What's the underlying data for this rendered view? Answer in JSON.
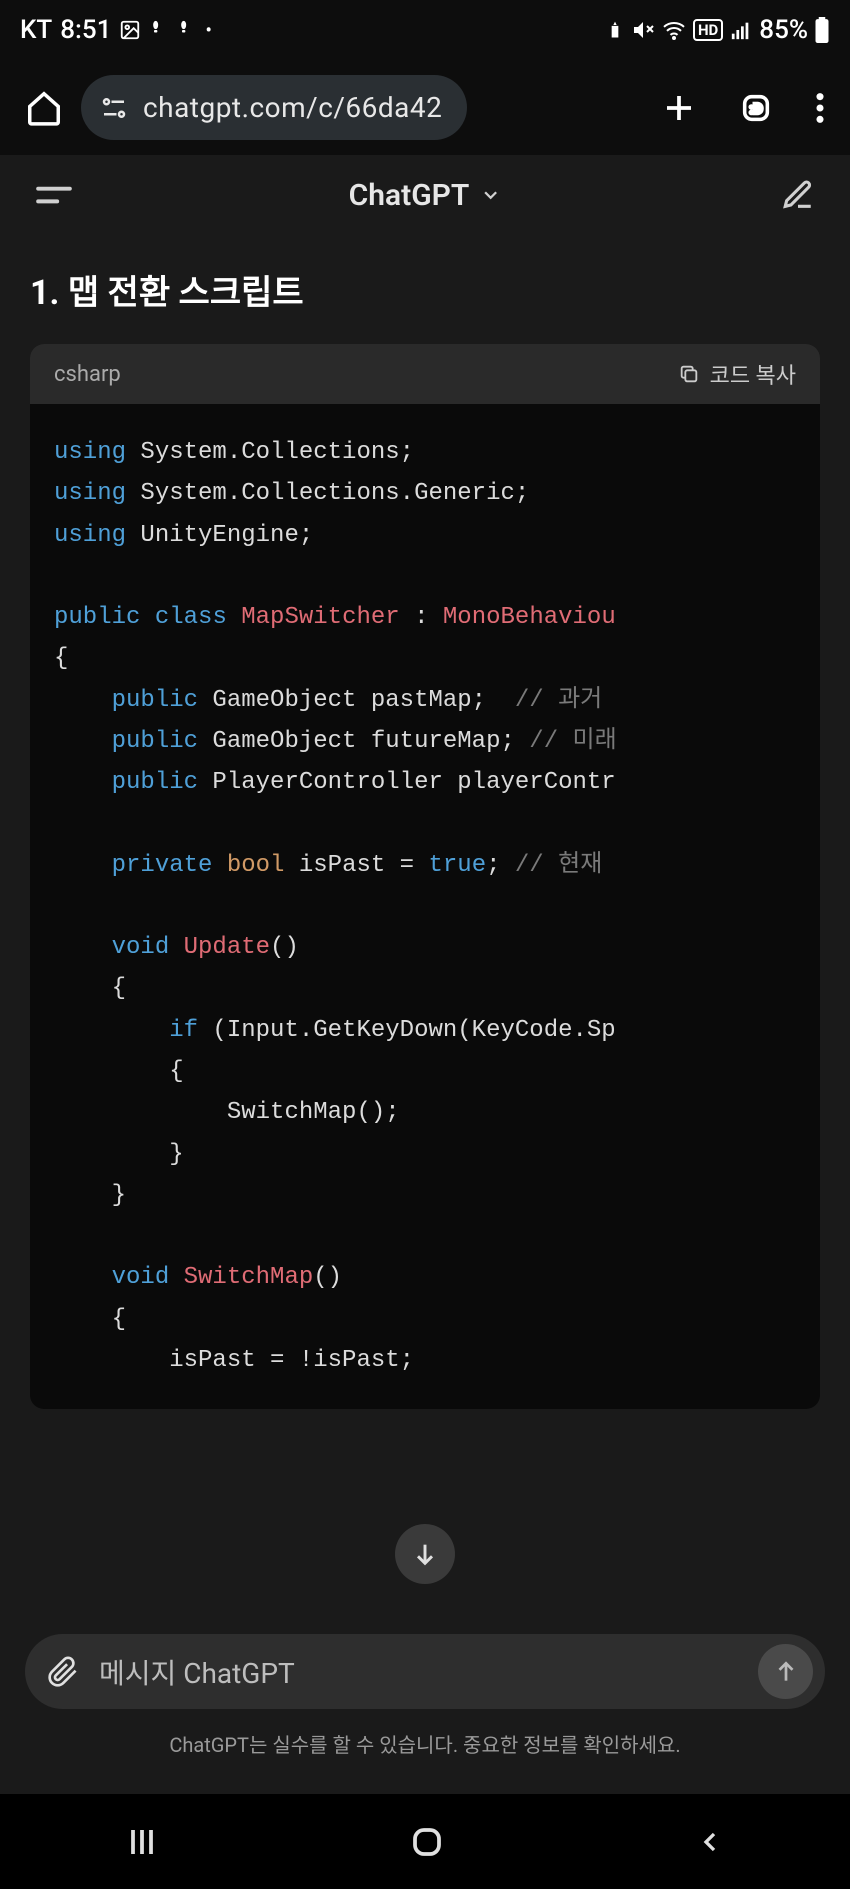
{
  "status": {
    "carrier": "KT",
    "time": "8:51",
    "battery": "85%"
  },
  "browser": {
    "url": "chatgpt.com/c/66da42"
  },
  "header": {
    "title": "ChatGPT"
  },
  "content": {
    "heading": "1. 맵 전환 스크립트",
    "code_lang": "csharp",
    "copy_label": "코드 복사"
  },
  "code": {
    "l1_using": "using",
    "l1_rest": " System.Collections;",
    "l2_using": "using",
    "l2_rest": " System.Collections.Generic;",
    "l3_using": "using",
    "l3_rest": " UnityEngine;",
    "l5_public": "public",
    "l5_class": "class",
    "l5_name": "MapSwitcher",
    "l5_colon": " : ",
    "l5_base": "MonoBehaviou",
    "l6_brace": "{",
    "l7_pub": "public",
    "l7_rest": " GameObject pastMap;  ",
    "l7_cmt": "// 과거",
    "l8_pub": "public",
    "l8_rest": " GameObject futureMap; ",
    "l8_cmt": "// 미래",
    "l9_pub": "public",
    "l9_rest": " PlayerController playerContr",
    "l11_priv": "private",
    "l11_bool": "bool",
    "l11_rest": " isPast = ",
    "l11_true": "true",
    "l11_semi": "; ",
    "l11_cmt": "// 현재",
    "l13_void": "void",
    "l13_name": "Update",
    "l13_paren": "()",
    "l14_brace": "{",
    "l15_if": "if",
    "l15_rest": " (Input.GetKeyDown(KeyCode.Sp",
    "l16_brace": "{",
    "l17_call": "SwitchMap();",
    "l18_brace": "}",
    "l19_brace": "}",
    "l21_void": "void",
    "l21_name": "SwitchMap",
    "l21_paren": "()",
    "l22_brace": "{",
    "l23_stmt": "isPast = !isPast;"
  },
  "input": {
    "placeholder": "메시지 ChatGPT"
  },
  "footer": {
    "disclaimer": "ChatGPT는 실수를 할 수 있습니다. 중요한 정보를 확인하세요."
  }
}
